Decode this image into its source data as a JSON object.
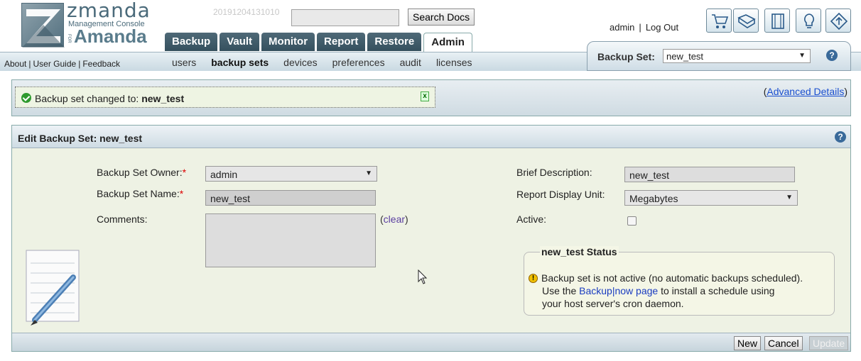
{
  "header": {
    "logo": {
      "brand": "zmanda",
      "subtitle": "Management Console",
      "for": "FOR",
      "product": "Amanda"
    },
    "timestamp": "20191204131010",
    "search": {
      "value": "",
      "button_label": "Search Docs"
    },
    "tabs": [
      {
        "label": "Backup",
        "active": false
      },
      {
        "label": "Vault",
        "active": false
      },
      {
        "label": "Monitor",
        "active": false
      },
      {
        "label": "Report",
        "active": false
      },
      {
        "label": "Restore",
        "active": false
      },
      {
        "label": "Admin",
        "active": true
      }
    ],
    "user": {
      "name": "admin",
      "separator": "|",
      "logout": "Log Out"
    },
    "toolbar_icons": [
      "cart-icon",
      "book-icon",
      "film-icon",
      "lightbulb-icon",
      "sign-icon"
    ]
  },
  "subnav": {
    "left_links": [
      "About",
      "User Guide",
      "Feedback"
    ],
    "left_separator": "|",
    "items": [
      {
        "label": "users",
        "active": false
      },
      {
        "label": "backup sets",
        "active": true
      },
      {
        "label": "devices",
        "active": false
      },
      {
        "label": "preferences",
        "active": false
      },
      {
        "label": "audit",
        "active": false
      },
      {
        "label": "licenses",
        "active": false
      }
    ]
  },
  "backup_set_selector": {
    "label": "Backup Set:",
    "value": "new_test"
  },
  "message": {
    "prefix": "Backup set changed to: ",
    "name": "new_test",
    "close_label": "x",
    "advanced_open": "(",
    "advanced_link": "Advanced Details",
    "advanced_close": ")"
  },
  "edit": {
    "title": "Edit Backup Set: new_test",
    "owner_label": "Backup Set Owner:",
    "owner_value": "admin",
    "name_label": "Backup Set Name:",
    "name_value": "new_test",
    "required_mark": "*",
    "comments_label": "Comments:",
    "comments_value": "",
    "clear_open": "(",
    "clear_link": "clear",
    "clear_close": ")",
    "description_label": "Brief Description:",
    "description_value": "new_test",
    "unit_label": "Report Display Unit:",
    "unit_value": "Megabytes",
    "active_label": "Active:",
    "active_checked": false
  },
  "status": {
    "legend": "new_test Status",
    "line1": "Backup set is not active (no automatic backups scheduled).",
    "line2_prefix": "Use the ",
    "line2_link": "Backup|now page",
    "line2_suffix": " to install a schedule using",
    "line3": "your host server's cron daemon.",
    "warn_glyph": "!"
  },
  "buttons": {
    "new": "New",
    "cancel": "Cancel",
    "update": "Update"
  },
  "help_glyph": "?",
  "caret_glyph": "▼"
}
